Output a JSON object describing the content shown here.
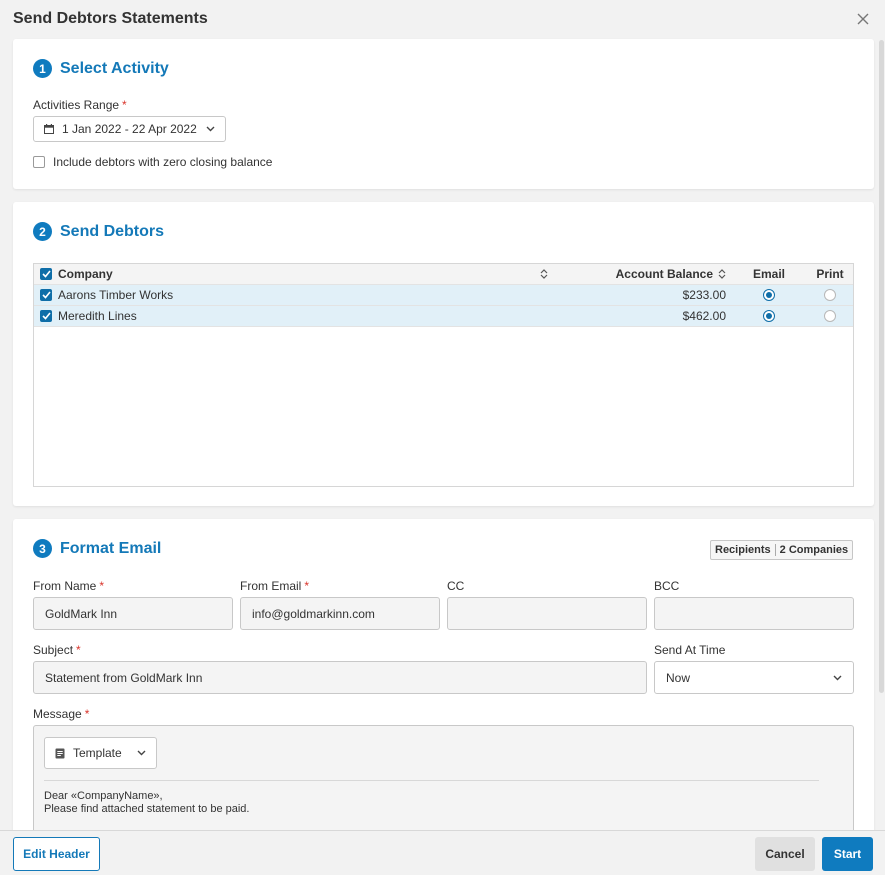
{
  "dialog": {
    "title": "Send Debtors Statements"
  },
  "select_activity": {
    "step": "1",
    "title": "Select Activity",
    "range_label": "Activities Range",
    "required_mark": "*",
    "date_range": "1 Jan 2022 - 22 Apr 2022",
    "zero_balance_label": "Include debtors with zero closing balance",
    "zero_balance_checked": false
  },
  "send_debtors": {
    "step": "2",
    "title": "Send Debtors",
    "columns": {
      "company": "Company",
      "balance": "Account Balance",
      "email": "Email",
      "print": "Print"
    },
    "rows": [
      {
        "company": "Aarons Timber Works",
        "balance": "$233.00",
        "selected": true,
        "method": "email"
      },
      {
        "company": "Meredith Lines",
        "balance": "$462.00",
        "selected": true,
        "method": "email"
      }
    ]
  },
  "format_email": {
    "step": "3",
    "title": "Format Email",
    "recipients_label": "Recipients",
    "recipients_value": "2 Companies",
    "from_name_label": "From Name",
    "from_name_value": "GoldMark Inn",
    "from_email_label": "From Email",
    "from_email_value": "info@goldmarkinn.com",
    "cc_label": "CC",
    "cc_value": "",
    "bcc_label": "BCC",
    "bcc_value": "",
    "subject_label": "Subject",
    "subject_value": "Statement from GoldMark Inn",
    "send_at_label": "Send At Time",
    "send_at_value": "Now",
    "message_label": "Message",
    "template_label": "Template",
    "message_line1": "Dear «CompanyName»,",
    "message_line2": "Please find attached statement to be paid."
  },
  "footer": {
    "edit_header": "Edit Header",
    "cancel": "Cancel",
    "start": "Start"
  },
  "colors": {
    "accent": "#0f7bbf",
    "selected_row": "#e1f0f8",
    "required": "#d9342b"
  }
}
